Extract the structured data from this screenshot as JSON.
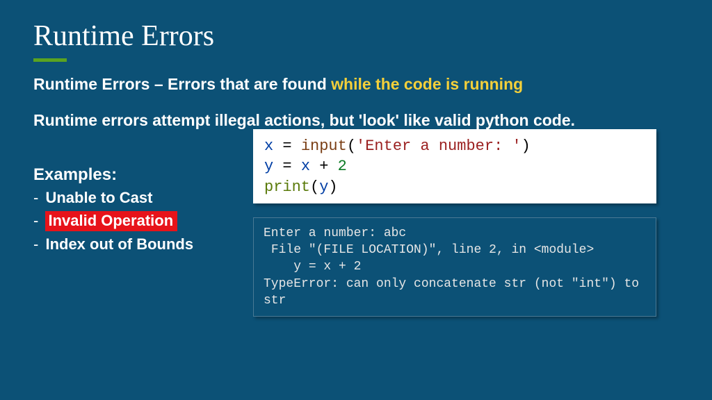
{
  "title": "Runtime Errors",
  "definition": {
    "prefix": "Runtime Errors – Errors that are found ",
    "highlight": "while the code is running"
  },
  "subdefinition": "Runtime errors attempt illegal actions, but 'look' like valid python code.",
  "examples": {
    "heading": "Examples:",
    "items": [
      {
        "text": "Unable to Cast",
        "highlighted": false
      },
      {
        "text": "Invalid Operation",
        "highlighted": true
      },
      {
        "text": "Index out of Bounds",
        "highlighted": false
      }
    ]
  },
  "code": {
    "line1_var": "x",
    "line1_fn": "input",
    "line1_str": "'Enter a number: '",
    "line2_var": "y",
    "line2_rhs_var": "x",
    "line2_num": "2",
    "line3_fn": "print",
    "line3_arg": "y"
  },
  "output": "Enter a number: abc\n File \"(FILE LOCATION)\", line 2, in <module>\n    y = x + 2\nTypeError: can only concatenate str (not \"int\") to str"
}
